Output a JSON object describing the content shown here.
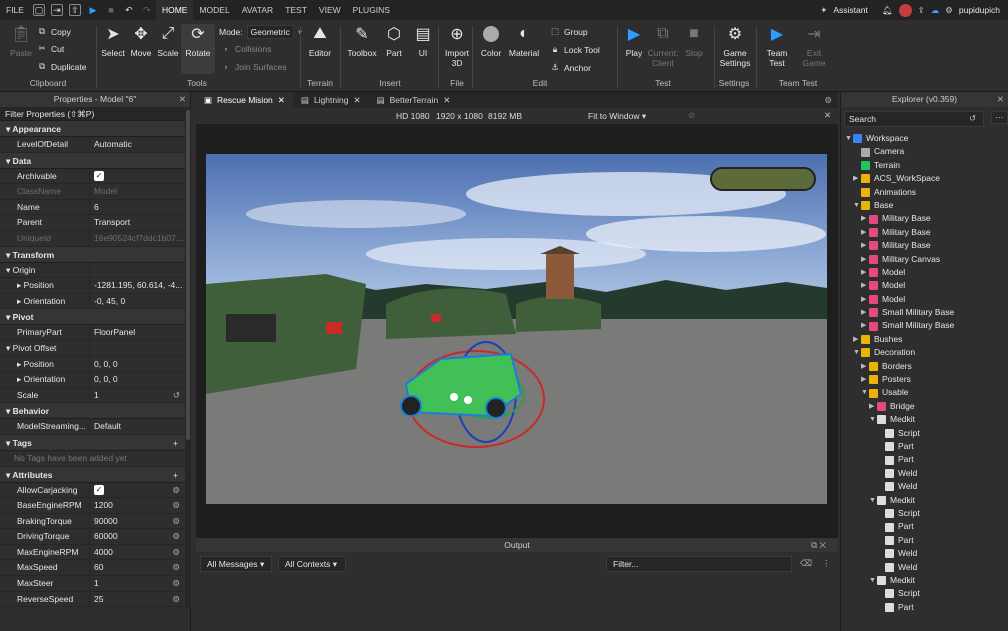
{
  "menubar": {
    "file": "FILE",
    "tabs": [
      "HOME",
      "MODEL",
      "AVATAR",
      "TEST",
      "VIEW",
      "PLUGINS"
    ],
    "assistant": "Assistant",
    "user": "pupidupich"
  },
  "ribbon": {
    "clipboard": {
      "paste": "Paste",
      "copy": "Copy",
      "cut": "Cut",
      "duplicate": "Duplicate",
      "group": "Clipboard"
    },
    "tools": {
      "select": "Select",
      "move": "Move",
      "scale": "Scale",
      "rotate": "Rotate",
      "mode_label": "Mode:",
      "mode_value": "Geometric",
      "collisions": "Collisions",
      "join": "Join Surfaces",
      "group": "Tools"
    },
    "terrain": {
      "editor": "Editor",
      "group": "Terrain"
    },
    "insert": {
      "toolbox": "Toolbox",
      "part": "Part",
      "ui": "UI",
      "group": "Insert"
    },
    "file": {
      "import": "Import 3D",
      "group": "File"
    },
    "edit": {
      "color": "Color",
      "material": "Material",
      "group_btn": "Group",
      "lock": "Lock Tool",
      "anchor": "Anchor",
      "group": "Edit"
    },
    "test": {
      "play": "Play",
      "current": "Current: Client",
      "stop": "Stop",
      "group": "Test"
    },
    "settings": {
      "game": "Game Settings",
      "group": "Settings"
    },
    "teamtest": {
      "team": "Team Test",
      "exit": "Exit Game",
      "group": "Team Test"
    }
  },
  "properties": {
    "title": "Properties - Model \"6\"",
    "filter": "Filter Properties (⇧⌘P)",
    "sections": {
      "appearance": "Appearance",
      "data": "Data",
      "transform": "Transform",
      "pivot": "Pivot",
      "behavior": "Behavior",
      "tags": "Tags",
      "attributes": "Attributes"
    },
    "appearance": [
      {
        "k": "LevelOfDetail",
        "v": "Automatic"
      }
    ],
    "data": [
      {
        "k": "Archivable",
        "v": ""
      },
      {
        "k": "ClassName",
        "v": "Model"
      },
      {
        "k": "Name",
        "v": "6"
      },
      {
        "k": "Parent",
        "v": "Transport"
      },
      {
        "k": "UniqueId",
        "v": "16e90524cf7ddc1b07..."
      }
    ],
    "transform": [
      {
        "k": "Origin",
        "v": ""
      },
      {
        "k": "Position",
        "v": "-1281.195, 60.614, -4..."
      },
      {
        "k": "Orientation",
        "v": "-0, 45, 0"
      }
    ],
    "pivot": [
      {
        "k": "PrimaryPart",
        "v": "FloorPanel"
      },
      {
        "k": "Pivot Offset",
        "v": ""
      },
      {
        "k": "Position",
        "v": "0, 0, 0"
      },
      {
        "k": "Orientation",
        "v": "0, 0, 0"
      },
      {
        "k": "Scale",
        "v": "1"
      }
    ],
    "behavior": [
      {
        "k": "ModelStreaming...",
        "v": "Default"
      }
    ],
    "tags_empty": "No Tags have been added yet",
    "attributes": [
      {
        "k": "AllowCarjacking",
        "v": ""
      },
      {
        "k": "BaseEngineRPM",
        "v": "1200"
      },
      {
        "k": "BrakingTorque",
        "v": "90000"
      },
      {
        "k": "DrivingTorque",
        "v": "60000"
      },
      {
        "k": "MaxEngineRPM",
        "v": "4000"
      },
      {
        "k": "MaxSpeed",
        "v": "60"
      },
      {
        "k": "MaxSteer",
        "v": "1"
      },
      {
        "k": "ReverseSpeed",
        "v": "25"
      }
    ]
  },
  "docs": {
    "tabs": [
      "Rescue Mision",
      "Lightning",
      "BetterTerrain"
    ]
  },
  "viewport_bar": {
    "res": "HD 1080",
    "size": "1920 x 1080",
    "mem": "8192 MB",
    "fit": "Fit to Window"
  },
  "output": {
    "title": "Output",
    "messages": "All Messages",
    "contexts": "All Contexts",
    "filter": "Filter..."
  },
  "explorer": {
    "title": "Explorer (v0.359)",
    "search": "Search",
    "items": [
      {
        "d": 0,
        "a": "▼",
        "n": "Workspace",
        "c": "#3b82f6"
      },
      {
        "d": 1,
        "a": "",
        "n": "Camera",
        "c": "#aaa"
      },
      {
        "d": 1,
        "a": "",
        "n": "Terrain",
        "c": "#22c55e"
      },
      {
        "d": 1,
        "a": "▶",
        "n": "ACS_WorkSpace",
        "c": "#eab308"
      },
      {
        "d": 1,
        "a": "",
        "n": "Animations",
        "c": "#eab308"
      },
      {
        "d": 1,
        "a": "▼",
        "n": "Base",
        "c": "#eab308"
      },
      {
        "d": 2,
        "a": "▶",
        "n": "Military Base",
        "c": "#e64980"
      },
      {
        "d": 2,
        "a": "▶",
        "n": "Military Base",
        "c": "#e64980"
      },
      {
        "d": 2,
        "a": "▶",
        "n": "Military Base",
        "c": "#e64980"
      },
      {
        "d": 2,
        "a": "▶",
        "n": "Military Canvas",
        "c": "#e64980"
      },
      {
        "d": 2,
        "a": "▶",
        "n": "Model",
        "c": "#e64980"
      },
      {
        "d": 2,
        "a": "▶",
        "n": "Model",
        "c": "#e64980"
      },
      {
        "d": 2,
        "a": "▶",
        "n": "Model",
        "c": "#e64980"
      },
      {
        "d": 2,
        "a": "▶",
        "n": "Small Military Base",
        "c": "#e64980"
      },
      {
        "d": 2,
        "a": "▶",
        "n": "Small Military Base",
        "c": "#e64980"
      },
      {
        "d": 1,
        "a": "▶",
        "n": "Bushes",
        "c": "#eab308"
      },
      {
        "d": 1,
        "a": "▼",
        "n": "Decoration",
        "c": "#eab308"
      },
      {
        "d": 2,
        "a": "▶",
        "n": "Borders",
        "c": "#eab308"
      },
      {
        "d": 2,
        "a": "▶",
        "n": "Posters",
        "c": "#eab308"
      },
      {
        "d": 2,
        "a": "▼",
        "n": "Usable",
        "c": "#eab308"
      },
      {
        "d": 3,
        "a": "▶",
        "n": "Bridge",
        "c": "#e64980"
      },
      {
        "d": 3,
        "a": "▼",
        "n": "Medkit",
        "c": "#ddd"
      },
      {
        "d": 4,
        "a": "",
        "n": "Script",
        "c": "#ddd"
      },
      {
        "d": 4,
        "a": "",
        "n": "Part",
        "c": "#ddd"
      },
      {
        "d": 4,
        "a": "",
        "n": "Part",
        "c": "#ddd"
      },
      {
        "d": 4,
        "a": "",
        "n": "Weld",
        "c": "#ddd"
      },
      {
        "d": 4,
        "a": "",
        "n": "Weld",
        "c": "#ddd"
      },
      {
        "d": 3,
        "a": "▼",
        "n": "Medkit",
        "c": "#ddd"
      },
      {
        "d": 4,
        "a": "",
        "n": "Script",
        "c": "#ddd"
      },
      {
        "d": 4,
        "a": "",
        "n": "Part",
        "c": "#ddd"
      },
      {
        "d": 4,
        "a": "",
        "n": "Part",
        "c": "#ddd"
      },
      {
        "d": 4,
        "a": "",
        "n": "Weld",
        "c": "#ddd"
      },
      {
        "d": 4,
        "a": "",
        "n": "Weld",
        "c": "#ddd"
      },
      {
        "d": 3,
        "a": "▼",
        "n": "Medkit",
        "c": "#ddd"
      },
      {
        "d": 4,
        "a": "",
        "n": "Script",
        "c": "#ddd"
      },
      {
        "d": 4,
        "a": "",
        "n": "Part",
        "c": "#ddd"
      }
    ]
  }
}
